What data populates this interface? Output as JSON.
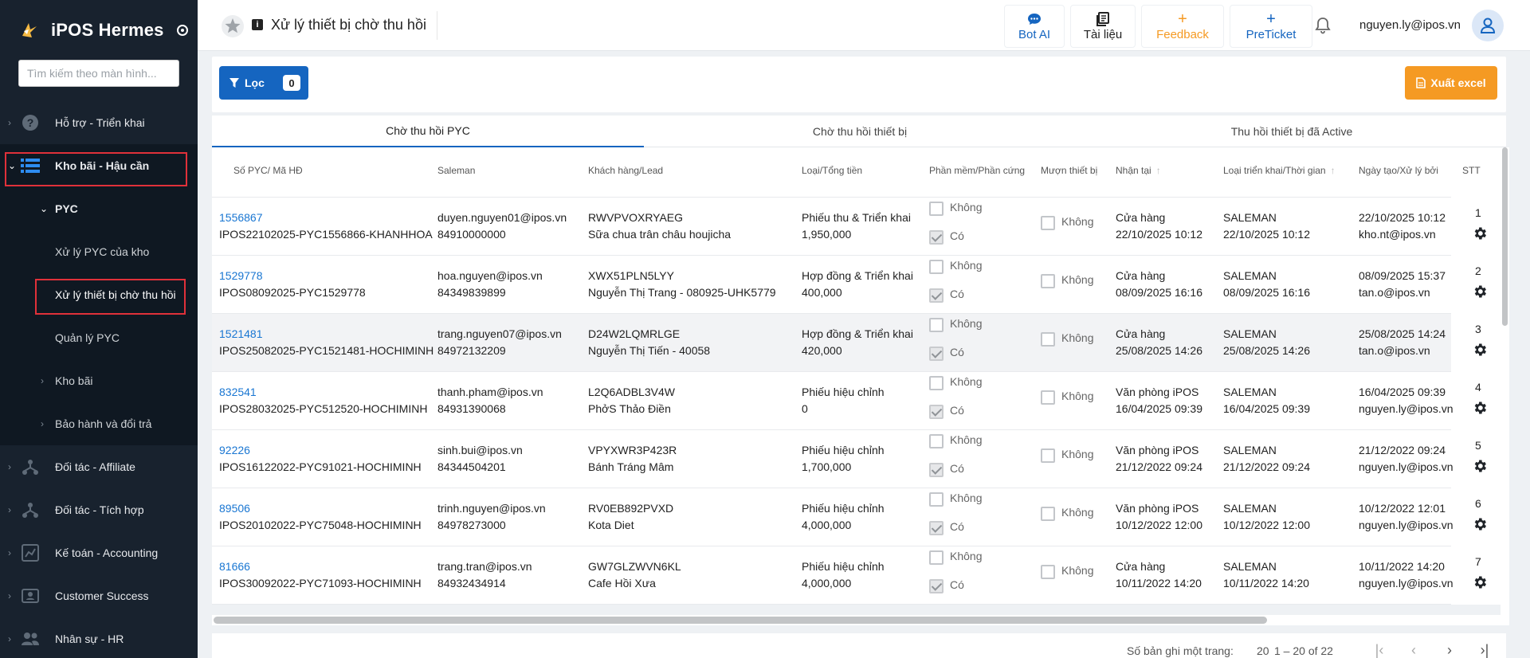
{
  "app": {
    "name": "iPOS Hermes"
  },
  "sidebar": {
    "search_placeholder": "Tìm kiếm theo màn hình...",
    "items": [
      {
        "label": "Hỗ trợ - Triển khai"
      },
      {
        "label": "Kho bãi - Hậu cần"
      },
      {
        "label": "PYC"
      },
      {
        "label": "Xử lý PYC của kho"
      },
      {
        "label": "Xử lý thiết bị chờ thu hồi"
      },
      {
        "label": "Quản lý PYC"
      },
      {
        "label": "Kho bãi"
      },
      {
        "label": "Bảo hành và đổi trả"
      },
      {
        "label": "Đối tác - Affiliate"
      },
      {
        "label": "Đối tác - Tích hợp"
      },
      {
        "label": "Kế toán - Accounting"
      },
      {
        "label": "Customer Success"
      },
      {
        "label": "Nhân sự - HR"
      }
    ]
  },
  "header": {
    "title": "Xử lý thiết bị chờ thu hồi",
    "buttons": [
      {
        "label": "Bot AI",
        "icon": "chat-icon"
      },
      {
        "label": "Tài liệu",
        "icon": "document-icon"
      },
      {
        "label": "Feedback",
        "icon": "plus-icon"
      },
      {
        "label": "PreTicket",
        "icon": "plus-icon"
      }
    ],
    "user_email": "nguyen.ly@ipos.vn"
  },
  "toolbar": {
    "filter_label": "Lọc",
    "filter_count": "0",
    "export_label": "Xuất excel"
  },
  "tabs": [
    "Chờ thu hồi PYC",
    "Chờ thu hồi thiết bị",
    "Thu hồi thiết bị đã Active"
  ],
  "table": {
    "columns": [
      "Số PYC/ Mã HĐ",
      "Saleman",
      "Khách hàng/Lead",
      "Loại/Tổng tiền",
      "Phần mềm/Phần cứng",
      "Mượn thiết bị",
      "Nhận tại",
      "Loại triển khai/Thời gian",
      "Ngày tạo/Xử lý bởi",
      "STT"
    ],
    "option_no": "Không",
    "option_yes": "Có",
    "rows": [
      {
        "pyc": "1556867",
        "contract": "IPOS22102025-PYC1556866-KHANHHOA",
        "sale_email": "duyen.nguyen01@ipos.vn",
        "sale_phone": "84910000000",
        "customer_code": "RWVPVOXRYAEG",
        "customer_name": "Sữa chua trân châu houjicha",
        "type": "Phiếu thu & Triển khai",
        "total": "1,950,000",
        "receive_at": "Cửa hàng",
        "receive_time": "22/10/2025 10:12",
        "deploy_type": "SALEMAN",
        "deploy_time": "22/10/2025 10:12",
        "created": "22/10/2025 10:12",
        "handler": "kho.nt@ipos.vn",
        "stt": "1"
      },
      {
        "pyc": "1529778",
        "contract": "IPOS08092025-PYC1529778",
        "sale_email": "hoa.nguyen@ipos.vn",
        "sale_phone": "84349839899",
        "customer_code": "XWX51PLN5LYY",
        "customer_name": "Nguyễn Thị Trang - 080925-UHK5779",
        "type": "Hợp đồng & Triển khai",
        "total": "400,000",
        "receive_at": "Cửa hàng",
        "receive_time": "08/09/2025 16:16",
        "deploy_type": "SALEMAN",
        "deploy_time": "08/09/2025 16:16",
        "created": "08/09/2025 15:37",
        "handler": "tan.o@ipos.vn",
        "stt": "2"
      },
      {
        "pyc": "1521481",
        "contract": "IPOS25082025-PYC1521481-HOCHIMINH",
        "sale_email": "trang.nguyen07@ipos.vn",
        "sale_phone": "84972132209",
        "customer_code": "D24W2LQMRLGE",
        "customer_name": "Nguyễn Thị Tiến - 40058",
        "type": "Hợp đồng & Triển khai",
        "total": "420,000",
        "receive_at": "Cửa hàng",
        "receive_time": "25/08/2025 14:26",
        "deploy_type": "SALEMAN",
        "deploy_time": "25/08/2025 14:26",
        "created": "25/08/2025 14:24",
        "handler": "tan.o@ipos.vn",
        "stt": "3"
      },
      {
        "pyc": "832541",
        "contract": "IPOS28032025-PYC512520-HOCHIMINH",
        "sale_email": "thanh.pham@ipos.vn",
        "sale_phone": "84931390068",
        "customer_code": "L2Q6ADBL3V4W",
        "customer_name": "PhởS Thảo Điền",
        "type": "Phiếu hiệu chỉnh",
        "total": "0",
        "receive_at": "Văn phòng iPOS",
        "receive_time": "16/04/2025 09:39",
        "deploy_type": "SALEMAN",
        "deploy_time": "16/04/2025 09:39",
        "created": "16/04/2025 09:39",
        "handler": "nguyen.ly@ipos.vn",
        "stt": "4"
      },
      {
        "pyc": "92226",
        "contract": "IPOS16122022-PYC91021-HOCHIMINH",
        "sale_email": "sinh.bui@ipos.vn",
        "sale_phone": "84344504201",
        "customer_code": "VPYXWR3P423R",
        "customer_name": "Bánh Tráng Mâm",
        "type": "Phiếu hiệu chỉnh",
        "total": "1,700,000",
        "receive_at": "Văn phòng iPOS",
        "receive_time": "21/12/2022 09:24",
        "deploy_type": "SALEMAN",
        "deploy_time": "21/12/2022 09:24",
        "created": "21/12/2022 09:24",
        "handler": "nguyen.ly@ipos.vn",
        "stt": "5"
      },
      {
        "pyc": "89506",
        "contract": "IPOS20102022-PYC75048-HOCHIMINH",
        "sale_email": "trinh.nguyen@ipos.vn",
        "sale_phone": "84978273000",
        "customer_code": "RV0EB892PVXD",
        "customer_name": "Kota Diet",
        "type": "Phiếu hiệu chỉnh",
        "total": "4,000,000",
        "receive_at": "Văn phòng iPOS",
        "receive_time": "10/12/2022 12:00",
        "deploy_type": "SALEMAN",
        "deploy_time": "10/12/2022 12:00",
        "created": "10/12/2022 12:01",
        "handler": "nguyen.ly@ipos.vn",
        "stt": "6"
      },
      {
        "pyc": "81666",
        "contract": "IPOS30092022-PYC71093-HOCHIMINH",
        "sale_email": "trang.tran@ipos.vn",
        "sale_phone": "84932434914",
        "customer_code": "GW7GLZWVN6KL",
        "customer_name": "Cafe Hồi Xưa",
        "type": "Phiếu hiệu chỉnh",
        "total": "4,000,000",
        "receive_at": "Cửa hàng",
        "receive_time": "10/11/2022 14:20",
        "deploy_type": "SALEMAN",
        "deploy_time": "10/11/2022 14:20",
        "created": "10/11/2022 14:20",
        "handler": "nguyen.ly@ipos.vn",
        "stt": "7"
      }
    ]
  },
  "footer": {
    "per_page_label": "Số bản ghi một trang:",
    "per_page_value": "20",
    "range": "1 – 20 of 22"
  },
  "colors": {
    "sidebar_bg": "#18222e",
    "primary": "#1565c0",
    "export": "#f59a23",
    "highlight_border": "#e0313a"
  }
}
